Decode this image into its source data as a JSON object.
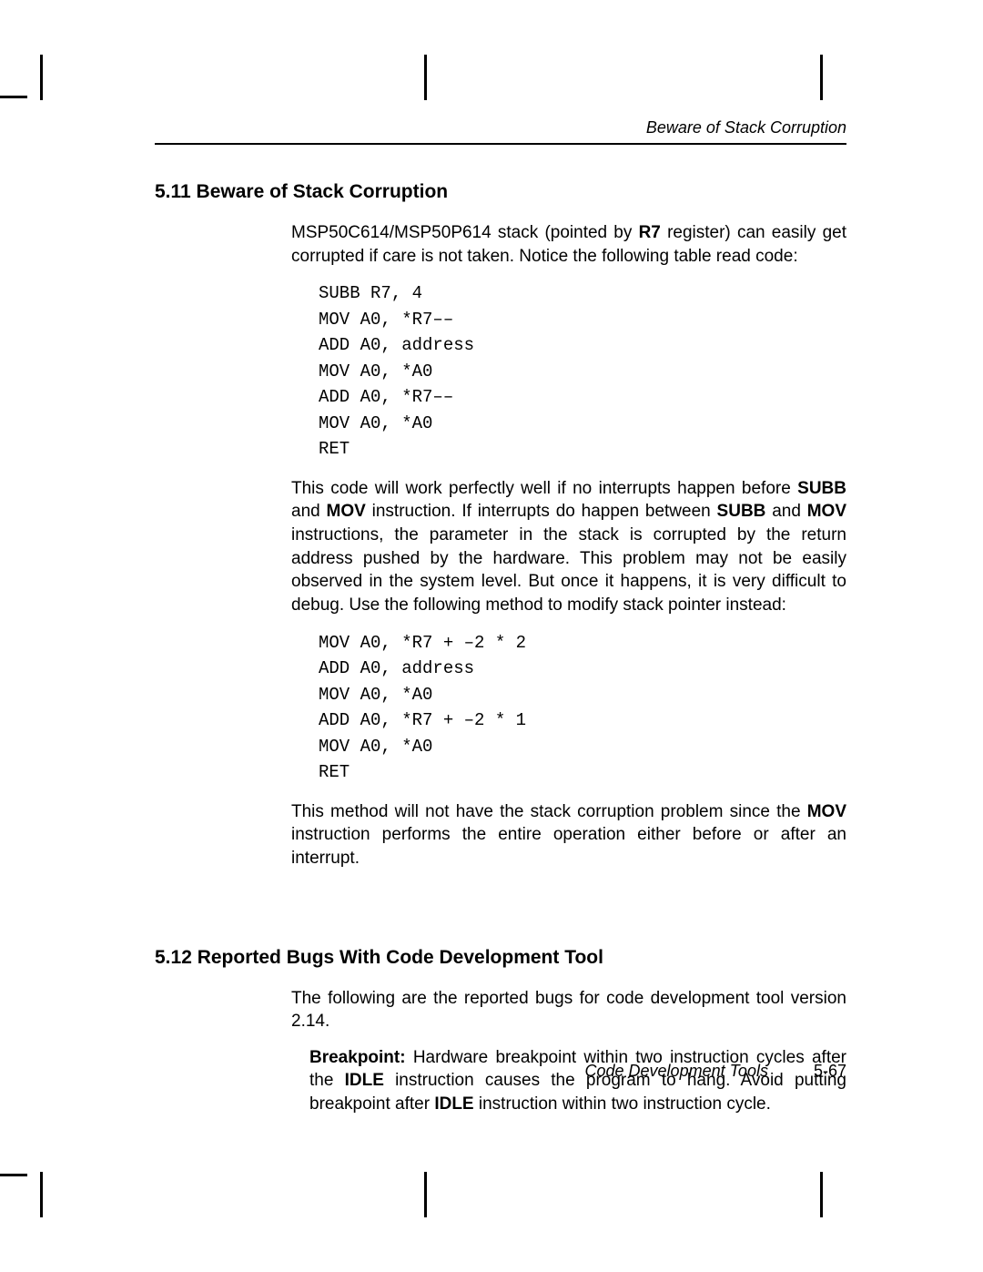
{
  "running_head": "Beware of Stack Corruption",
  "section1": {
    "heading": "5.11 Beware of Stack Corruption",
    "p1_a": "MSP50C614/MSP50P614 stack (pointed by ",
    "p1_b": "R7",
    "p1_c": " register) can easily get corrupted if care is not taken. Notice the following table read code:",
    "code1": "SUBB R7, 4\nMOV A0, *R7––\nADD A0, address\nMOV A0, *A0\nADD A0, *R7––\nMOV A0, *A0\nRET",
    "p2_a": "This code will work perfectly well if no interrupts happen before ",
    "p2_b": "SUBB",
    "p2_c": " and ",
    "p2_d": "MOV",
    "p2_e": " instruction. If interrupts do happen between ",
    "p2_f": "SUBB",
    "p2_g": " and ",
    "p2_h": "MOV",
    "p2_i": " instructions, the parameter in the stack is corrupted by the return address pushed by the hardware. This problem may not be easily observed in the system level. But once it happens, it is very difficult to debug. Use the following method to modify stack pointer instead:",
    "code2": "MOV A0, *R7 + –2 * 2\nADD A0, address\nMOV A0, *A0\nADD A0, *R7 + –2 * 1\nMOV A0, *A0\nRET",
    "p3_a": "This method will not have the stack corruption problem since the ",
    "p3_b": "MOV",
    "p3_c": " instruction performs the entire operation either before or after an interrupt."
  },
  "section2": {
    "heading": "5.12 Reported Bugs With Code Development Tool",
    "p1": "The following are the reported bugs for code development tool version 2.14.",
    "bug_a": "Breakpoint:",
    "bug_b": " Hardware breakpoint within two instruction cycles after the ",
    "bug_c": "IDLE",
    "bug_d": " instruction causes the program to hang. Avoid putting breakpoint after ",
    "bug_e": "IDLE",
    "bug_f": " instruction within two instruction cycle."
  },
  "footer": {
    "title": "Code Development Tools",
    "page": "5-67"
  }
}
